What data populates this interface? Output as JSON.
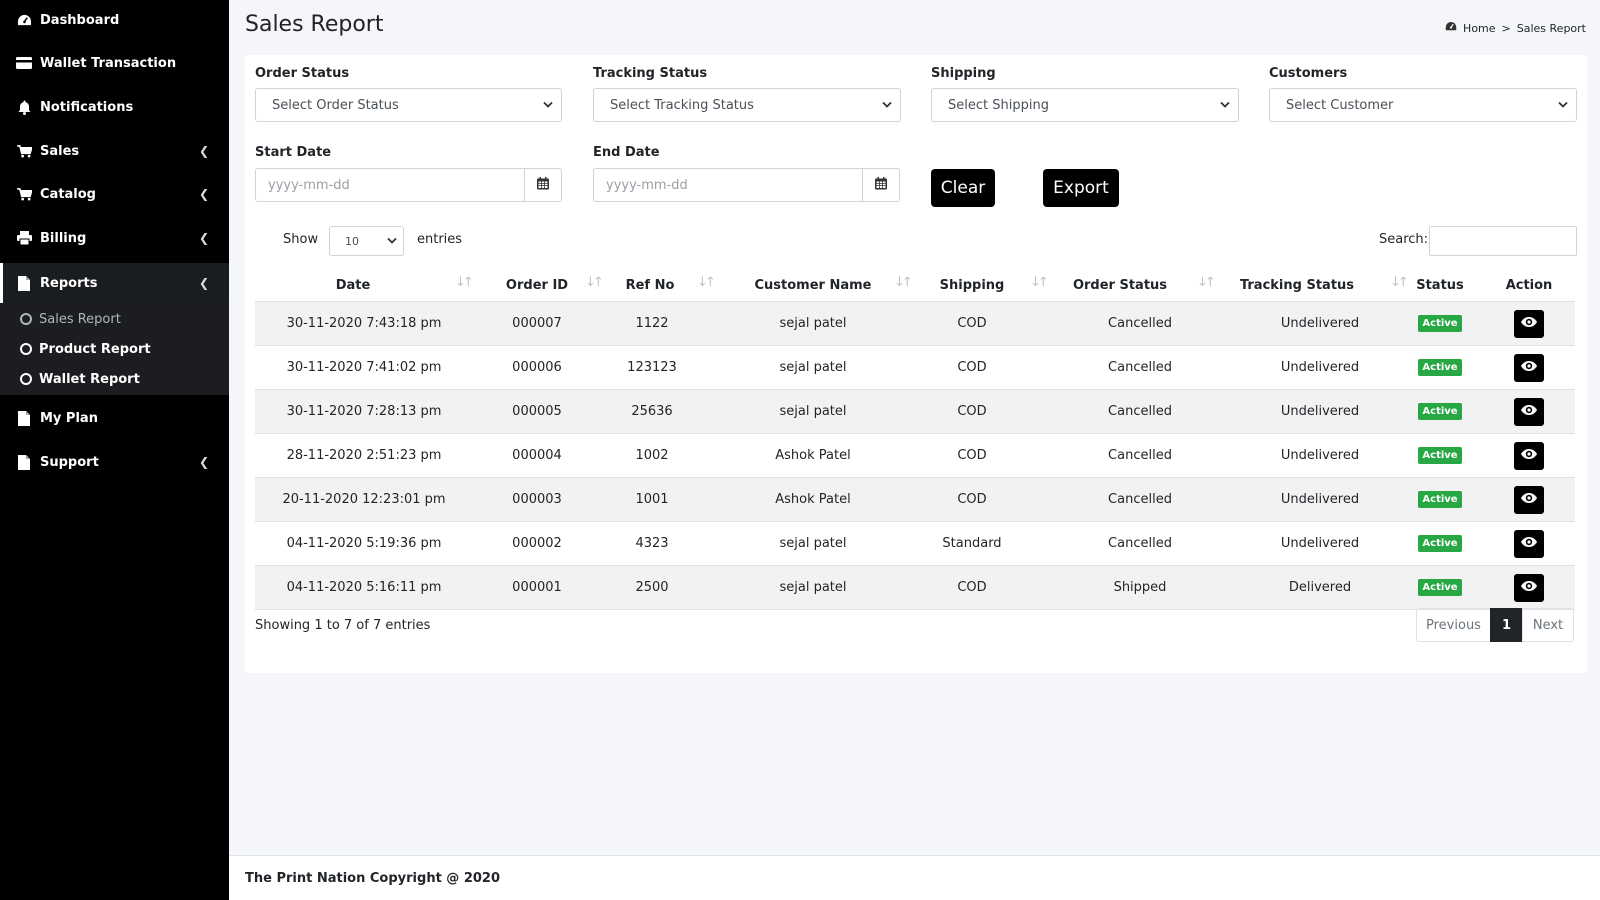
{
  "sidebar": {
    "items": [
      {
        "label": "Dashboard",
        "icon": "dashboard-icon"
      },
      {
        "label": "Wallet Transaction",
        "icon": "credit-card-icon"
      },
      {
        "label": "Notifications",
        "icon": "bell-icon"
      },
      {
        "label": "Sales",
        "icon": "cart-icon"
      },
      {
        "label": "Catalog",
        "icon": "cart-icon"
      },
      {
        "label": "Billing",
        "icon": "printer-icon"
      },
      {
        "label": "Reports",
        "icon": "file-icon"
      },
      {
        "label": "My Plan",
        "icon": "file-icon"
      },
      {
        "label": "Support",
        "icon": "file-icon"
      }
    ],
    "reports_sub": [
      {
        "label": "Sales Report"
      },
      {
        "label": "Product Report"
      },
      {
        "label": "Wallet Report"
      }
    ]
  },
  "header": {
    "title": "Sales Report",
    "breadcrumb_home": "Home",
    "breadcrumb_sep": ">",
    "breadcrumb_current": "Sales Report"
  },
  "filters": {
    "order_status_label": "Order Status",
    "order_status_value": "Select Order Status",
    "tracking_status_label": "Tracking Status",
    "tracking_status_value": "Select Tracking Status",
    "shipping_label": "Shipping",
    "shipping_value": "Select Shipping",
    "customers_label": "Customers",
    "customers_value": "Select Customer",
    "start_date_label": "Start Date",
    "start_date_placeholder": "yyyy-mm-dd",
    "end_date_label": "End Date",
    "end_date_placeholder": "yyyy-mm-dd",
    "clear_label": "Clear",
    "export_label": "Export"
  },
  "table_controls": {
    "show_label": "Show",
    "entries_value": "10",
    "entries_label": "entries",
    "search_label": "Search:"
  },
  "table": {
    "columns": [
      "Date",
      "Order ID",
      "Ref No",
      "Customer Name",
      "Shipping",
      "Order Status",
      "Tracking Status",
      "Status",
      "Action"
    ],
    "rows": [
      {
        "date": "30-11-2020 7:43:18 pm",
        "order_id": "000007",
        "ref_no": "1122",
        "customer": "sejal patel",
        "shipping": "COD",
        "order_status": "Cancelled",
        "tracking_status": "Undelivered",
        "status": "Active"
      },
      {
        "date": "30-11-2020 7:41:02 pm",
        "order_id": "000006",
        "ref_no": "123123",
        "customer": "sejal patel",
        "shipping": "COD",
        "order_status": "Cancelled",
        "tracking_status": "Undelivered",
        "status": "Active"
      },
      {
        "date": "30-11-2020 7:28:13 pm",
        "order_id": "000005",
        "ref_no": "25636",
        "customer": "sejal patel",
        "shipping": "COD",
        "order_status": "Cancelled",
        "tracking_status": "Undelivered",
        "status": "Active"
      },
      {
        "date": "28-11-2020 2:51:23 pm",
        "order_id": "000004",
        "ref_no": "1002",
        "customer": "Ashok Patel",
        "shipping": "COD",
        "order_status": "Cancelled",
        "tracking_status": "Undelivered",
        "status": "Active"
      },
      {
        "date": "20-11-2020 12:23:01 pm",
        "order_id": "000003",
        "ref_no": "1001",
        "customer": "Ashok Patel",
        "shipping": "COD",
        "order_status": "Cancelled",
        "tracking_status": "Undelivered",
        "status": "Active"
      },
      {
        "date": "04-11-2020 5:19:36 pm",
        "order_id": "000002",
        "ref_no": "4323",
        "customer": "sejal patel",
        "shipping": "Standard",
        "order_status": "Cancelled",
        "tracking_status": "Undelivered",
        "status": "Active"
      },
      {
        "date": "04-11-2020 5:16:11 pm",
        "order_id": "000001",
        "ref_no": "2500",
        "customer": "sejal patel",
        "shipping": "COD",
        "order_status": "Shipped",
        "tracking_status": "Delivered",
        "status": "Active"
      }
    ],
    "info": "Showing 1 to 7 of 7 entries"
  },
  "pagination": {
    "previous": "Previous",
    "current": "1",
    "next": "Next"
  },
  "footer": {
    "text": "The Print Nation Copyright @ 2020"
  },
  "colors": {
    "sidebar_bg": "#000000",
    "active_badge": "#28a745",
    "primary_button": "#000000",
    "row_stripe": "#f2f2f2"
  }
}
